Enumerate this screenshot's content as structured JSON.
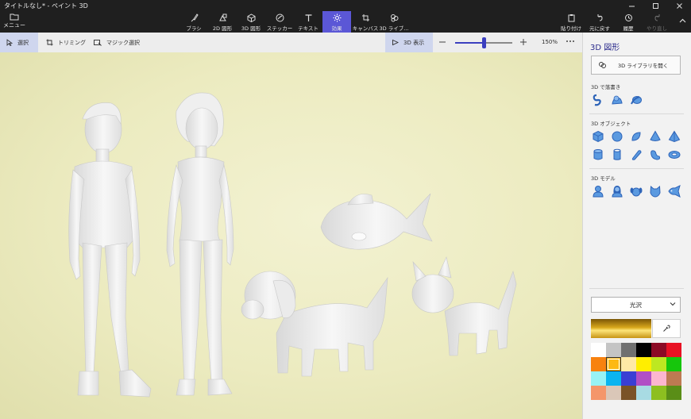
{
  "window": {
    "title": "タイトルなし* - ペイント 3D"
  },
  "ribbon": {
    "menu_label": "メニュー",
    "tools": [
      {
        "label": "ブラシ",
        "icon": "brush-icon",
        "active": false
      },
      {
        "label": "2D 図形",
        "icon": "2d-shapes-icon",
        "active": false
      },
      {
        "label": "3D 図形",
        "icon": "3d-shapes-icon",
        "active": false
      },
      {
        "label": "ステッカー",
        "icon": "stickers-icon",
        "active": false
      },
      {
        "label": "テキスト",
        "icon": "text-icon",
        "active": false
      },
      {
        "label": "効果",
        "icon": "effects-icon",
        "active": true
      },
      {
        "label": "キャンバス",
        "icon": "canvas-icon",
        "active": false
      },
      {
        "label": "3D ライブ...",
        "icon": "3d-library-icon",
        "active": false
      }
    ],
    "right_tools": [
      {
        "label": "貼り付け",
        "icon": "paste-icon"
      },
      {
        "label": "元に戻す",
        "icon": "undo-icon"
      },
      {
        "label": "履歴",
        "icon": "history-icon"
      },
      {
        "label": "やり直し",
        "icon": "redo-icon"
      }
    ]
  },
  "subbar": {
    "select_label": "選択",
    "crop_label": "トリミング",
    "magic_select_label": "マジック選択",
    "view3d_label": "3D 表示",
    "zoom_label": "150%",
    "zoom_fraction": 0.5
  },
  "panel": {
    "title": "3D 図形",
    "library_button": "3D ライブラリを開く",
    "doodle_title": "3D で落書き",
    "doodle_icons": [
      "sharp-doodle-icon",
      "soft-doodle-icon",
      "tube-doodle-icon"
    ],
    "objects_title": "3D オブジェクト",
    "object_icons_row1": [
      "cube-icon",
      "sphere-icon",
      "hemisphere-icon",
      "cone-icon",
      "pyramid-icon"
    ],
    "object_icons_row2": [
      "cylinder-icon",
      "tube-icon",
      "capsule-icon",
      "bean-icon",
      "donut-icon"
    ],
    "models_title": "3D モデル",
    "model_icons": [
      "man-model-icon",
      "woman-model-icon",
      "dog-model-icon",
      "cat-model-icon",
      "fish-model-icon"
    ],
    "material_label": "光沢",
    "current_color": "#d9a81c",
    "palette": [
      "#ffffff",
      "#c4c4c4",
      "#707070",
      "#000000",
      "#8b0a25",
      "#e81123",
      "#f7820f",
      "#fdb913",
      "#ffe9a6",
      "#ffee00",
      "#bde821",
      "#16c60c",
      "#98f2f5",
      "#0ab4f0",
      "#3a3fd4",
      "#b14fc5",
      "#fcb6cf",
      "#bd7a52",
      "#f4966a",
      "#dac7b8",
      "#7a5327",
      "#a8dbe3",
      "#8dbf20",
      "#5a8e17"
    ],
    "selected_swatch": 7
  }
}
